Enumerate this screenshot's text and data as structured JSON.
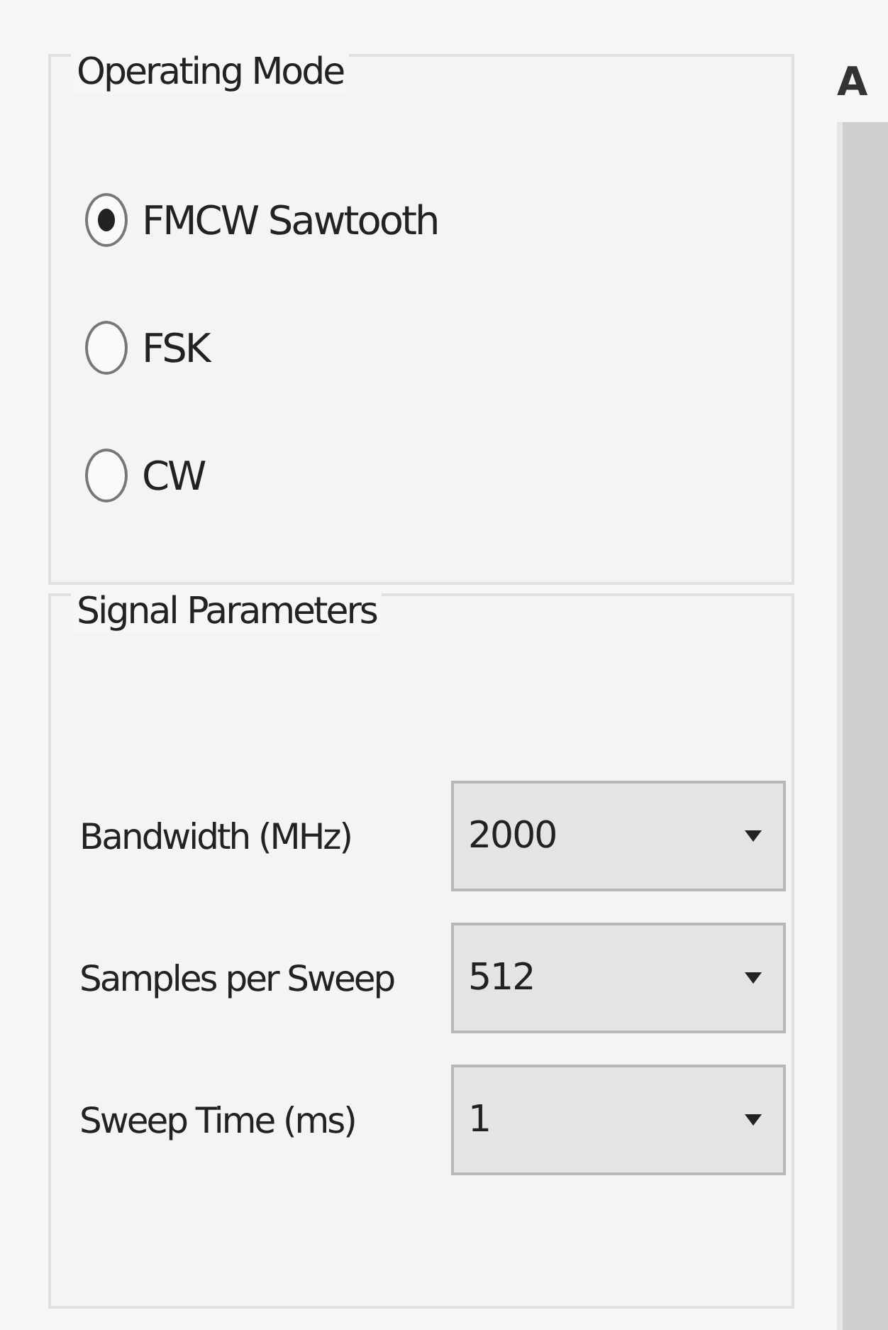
{
  "operating_mode": {
    "title": "Operating Mode",
    "options": [
      {
        "label": "FMCW Sawtooth",
        "selected": true
      },
      {
        "label": "FSK",
        "selected": false
      },
      {
        "label": "CW",
        "selected": false
      }
    ]
  },
  "signal_parameters": {
    "title": "Signal Parameters",
    "fields": [
      {
        "label": "Bandwidth (MHz)",
        "value": "2000"
      },
      {
        "label": "Samples per Sweep",
        "value": "512"
      },
      {
        "label": "Sweep Time (ms)",
        "value": "1"
      }
    ]
  },
  "side_panel": {
    "title": "A"
  }
}
